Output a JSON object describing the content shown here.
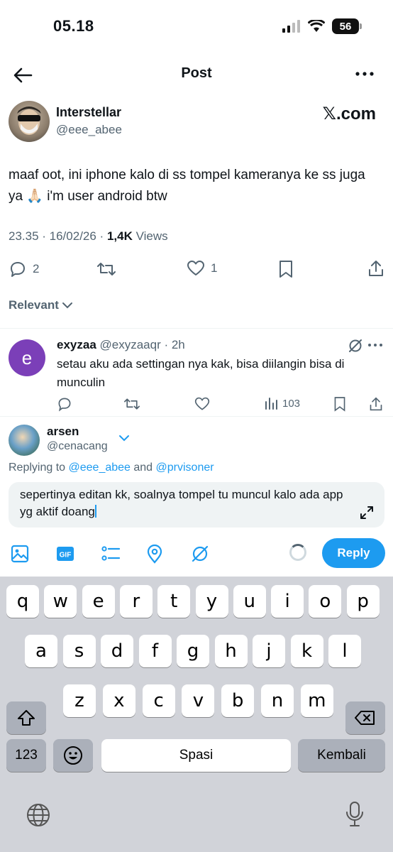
{
  "status_bar": {
    "time": "05.18",
    "battery": "56"
  },
  "nav": {
    "title": "Post"
  },
  "tweet": {
    "author_name": "Interstellar",
    "author_handle": "@eee_abee",
    "source_logo": "𝕏.com",
    "text": "maaf oot, ini iphone kalo di ss tompel kameranya ke ss juga ya 🙏🏻 i'm user android btw",
    "timestamp": "23.35 · 16/02/26 · ",
    "views_count": "1,4K",
    "views_label": " Views",
    "replies": "2",
    "likes": "1"
  },
  "sort": {
    "label": "Relevant"
  },
  "reply": {
    "avatar_letter": "e",
    "name": "exyzaa",
    "handle_time": " @exyzaaqr · 2h",
    "text": "setau aku ada settingan nya kak, bisa diilangin bisa di munculin",
    "views": "103"
  },
  "composer": {
    "name": "arsen",
    "handle": "@cenacang",
    "replying_prefix": "Replying to ",
    "replying_user1": "@eee_abee",
    "replying_and": " and ",
    "replying_user2": "@prvisoner",
    "draft": "sepertinya editan kk, soalnya tompel tu muncul kalo ada app yg aktif doang",
    "reply_button": "Reply"
  },
  "keyboard": {
    "row1": [
      "q",
      "w",
      "e",
      "r",
      "t",
      "y",
      "u",
      "i",
      "o",
      "p"
    ],
    "row2": [
      "a",
      "s",
      "d",
      "f",
      "g",
      "h",
      "j",
      "k",
      "l"
    ],
    "row3": [
      "z",
      "x",
      "c",
      "v",
      "b",
      "n",
      "m"
    ],
    "numbers": "123",
    "space": "Spasi",
    "return": "Kembali"
  },
  "colors": {
    "accent": "#1d9bf0",
    "text": "#0f1419",
    "muted": "#536471",
    "reply_avatar": "#7b3fb8",
    "keyboard_bg": "#d1d3d9"
  },
  "icons": [
    "back-arrow-icon",
    "more-icon",
    "reply-icon",
    "repost-icon",
    "like-icon",
    "bookmark-icon",
    "share-icon",
    "views-icon",
    "grok-icon",
    "image-icon",
    "gif-icon",
    "poll-icon",
    "location-icon",
    "expand-icon",
    "shift-icon",
    "backspace-icon",
    "emoji-icon",
    "globe-icon",
    "mic-icon"
  ]
}
